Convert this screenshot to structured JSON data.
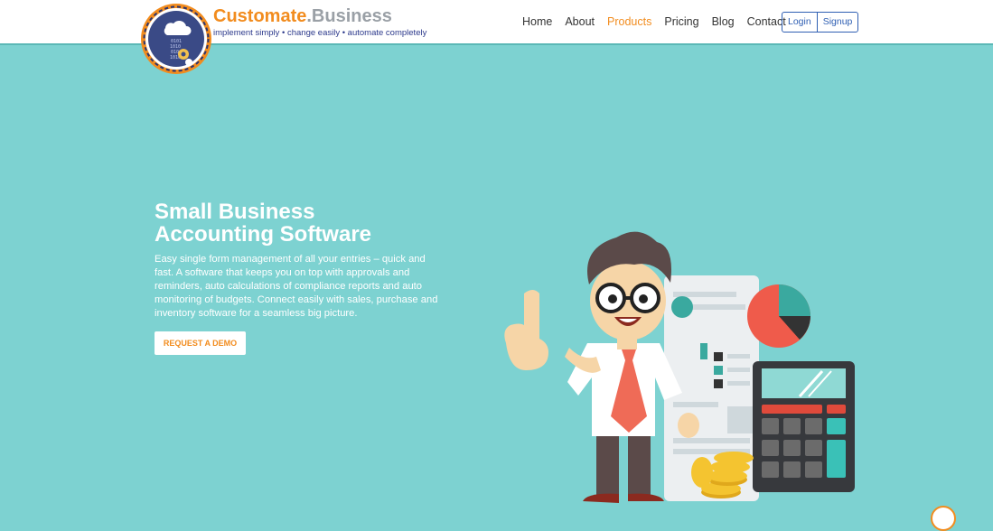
{
  "brand": {
    "name_main": "Customate",
    "name_sep": ".",
    "name_suffix": "Business",
    "tagline": "implement simply • change easily • automate completely",
    "logo_digits": [
      "0101",
      "1010",
      "010",
      "1010"
    ]
  },
  "nav": {
    "items": [
      {
        "label": "Home"
      },
      {
        "label": "About"
      },
      {
        "label": "Products"
      },
      {
        "label": "Pricing"
      },
      {
        "label": "Blog"
      },
      {
        "label": "Contact"
      }
    ],
    "active": "Products"
  },
  "auth": {
    "login": "Login",
    "signup": "Signup"
  },
  "hero": {
    "title_line1": "Small Business",
    "title_line2": "Accounting Software",
    "description": "Easy single form management of all your entries – quick and fast. A software that keeps you on top with approvals and reminders, auto calculations of compliance reports and auto monitoring of budgets. Connect easily with sales, purchase and inventory software for a seamless big picture.",
    "cta": "Request a Demo"
  },
  "colors": {
    "background": "#7dd2d1",
    "accent": "#f28c1e",
    "nav_blue": "#2f5fb3",
    "logo_navy": "#3a4a86"
  },
  "icons": {
    "logo": "cloud-gear-logo-icon",
    "illustration": "accountant-calculator-illustration"
  }
}
